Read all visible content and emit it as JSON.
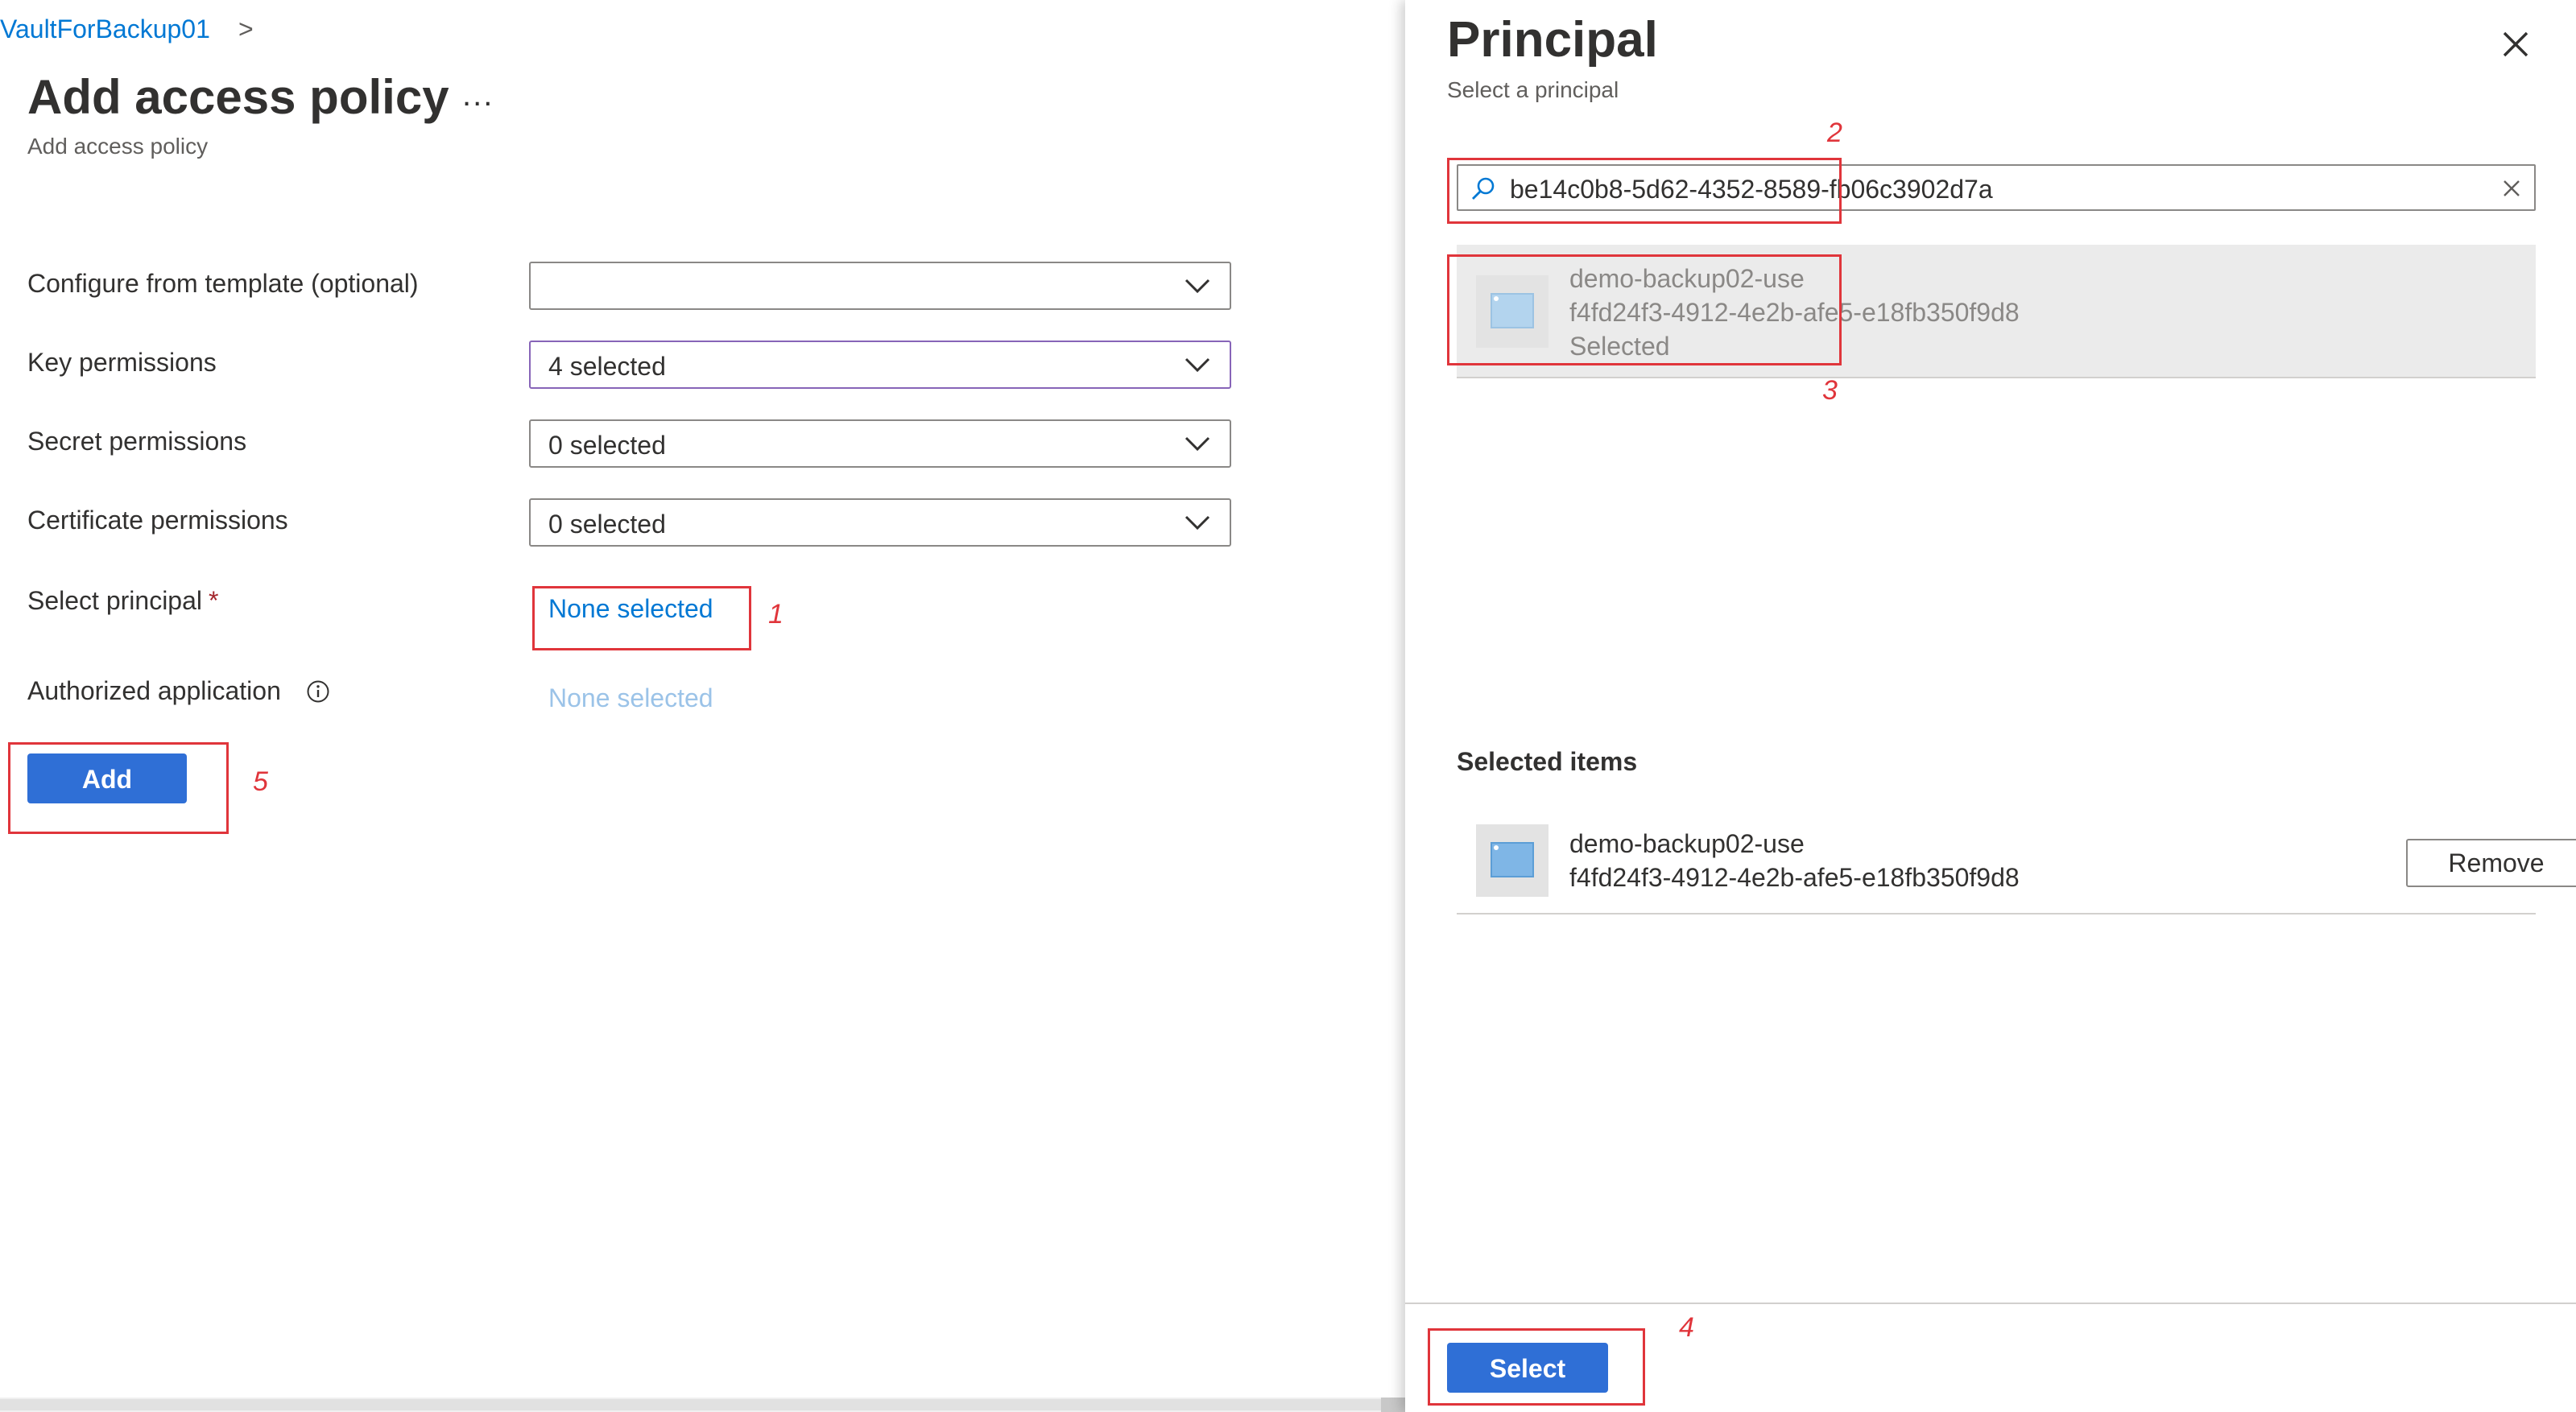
{
  "breadcrumb": {
    "text": "VaultForBackup01",
    "chevron": ">"
  },
  "page": {
    "title": "Add access policy",
    "more_label": "...",
    "subtitle": "Add access policy"
  },
  "form": {
    "template_label": "Configure from template (optional)",
    "template_value": "",
    "key_label": "Key permissions",
    "key_value": "4 selected",
    "secret_label": "Secret permissions",
    "secret_value": "0 selected",
    "cert_label": "Certificate permissions",
    "cert_value": "0 selected",
    "principal_label": "Select principal",
    "principal_required": "*",
    "principal_value": "None selected",
    "authorized_label": "Authorized application",
    "authorized_value": "None selected",
    "add_button": "Add"
  },
  "panel": {
    "title": "Principal",
    "subtitle": "Select a principal",
    "search_value": "be14c0b8-5d62-4352-8589-fb06c3902d7a",
    "result": {
      "name": "demo-backup02-use",
      "id": "f4fd24f3-4912-4e2b-afe5-e18fb350f9d8",
      "status": "Selected"
    },
    "selected_heading": "Selected items",
    "selected_item": {
      "name": "demo-backup02-use",
      "id": "f4fd24f3-4912-4e2b-afe5-e18fb350f9d8",
      "remove_label": "Remove"
    },
    "select_button": "Select"
  },
  "annotations": {
    "n1": "1",
    "n2": "2",
    "n3": "3",
    "n4": "4",
    "n5": "5",
    "color": "#e0353b"
  },
  "colors": {
    "accent": "#0078d4",
    "primary_button": "#2f6fd6",
    "focus_border": "#8764b8"
  },
  "icons": [
    "chevron-right-icon",
    "chevron-down-icon",
    "info-icon",
    "search-icon",
    "clear-icon",
    "close-icon",
    "app-registration-icon"
  ]
}
